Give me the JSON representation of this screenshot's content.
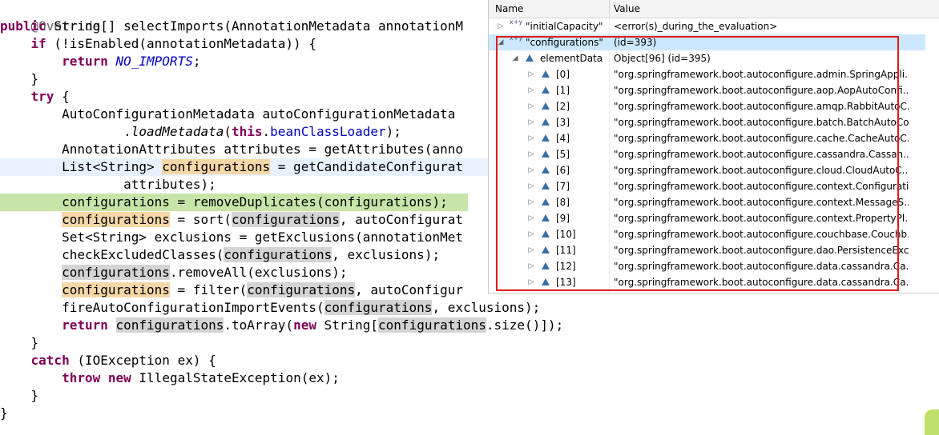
{
  "code": {
    "override": "@Override",
    "l1_public": "public",
    "l1_rest": " String[] selectImports(AnnotationMetadata annotationM",
    "l2_if": "if",
    "l2_rest": " (!isEnabled(annotationMetadata)) {",
    "l3_return": "return",
    "l3_const": "NO_IMPORTS",
    "l3_end": ";",
    "close_brace": "}",
    "l5_try": "try",
    "l5_rest": " {",
    "l6": "AutoConfigurationMetadata autoConfigurationMetadata",
    "l7_dot": ".",
    "l7_method": "loadMetadata",
    "l7_open": "(",
    "l7_this": "this",
    "l7_dot2": ".",
    "l7_field": "beanClassLoader",
    "l7_end": ");",
    "l8": "AnnotationAttributes attributes = getAttributes(anno",
    "l9_a": "List<String> ",
    "l9_var": "configurations",
    "l9_b": " = getCandidateConfigurat",
    "l10": "attributes);",
    "l11": "configurations = removeDuplicates(configurations);",
    "l12_var": "configurations",
    "l12_a": " = sort(",
    "l12_var2": "configurations",
    "l12_b": ", autoConfigurat",
    "l13": "Set<String> exclusions = getExclusions(annotationMet",
    "l14_a": "checkExcludedClasses(",
    "l14_var": "configurations",
    "l14_b": ", exclusions);",
    "l15_var": "configurations",
    "l15_b": ".removeAll(exclusions);",
    "l16_var": "configurations",
    "l16_a": " = filter(",
    "l16_var2": "configurations",
    "l16_b": ", autoConfigur",
    "l17_a": "fireAutoConfigurationImportEvents(",
    "l17_var": "configurations",
    "l17_b": ", exclusions);",
    "l18_return": "return",
    "l18_sp": " ",
    "l18_var": "configurations",
    "l18_a": ".toArray(",
    "l18_new": "new",
    "l18_b": " String[",
    "l18_var2": "configurations",
    "l18_c": ".size()]);",
    "l20_catch": "catch",
    "l20_rest": " (IOException ex) {",
    "l21_throw": "throw",
    "l21_sp": " ",
    "l21_new": "new",
    "l21_rest": " IllegalStateException(ex);"
  },
  "variables": {
    "header_name": "Name",
    "header_value": "Value",
    "initial_capacity": {
      "name": "\"initialCapacity\"",
      "value": "<error(s)_during_the_evaluation>"
    },
    "configurations": {
      "name": "\"configurations\"",
      "value": "(id=393)"
    },
    "element_data": {
      "name": "elementData",
      "value": "Object[96]  (id=395)"
    },
    "elements": [
      {
        "index": "[0]",
        "value": "\"org.springframework.boot.autoconfigure.admin.SpringAppli..."
      },
      {
        "index": "[1]",
        "value": "\"org.springframework.boot.autoconfigure.aop.AopAutoConfi..."
      },
      {
        "index": "[2]",
        "value": "\"org.springframework.boot.autoconfigure.amqp.RabbitAutoC..."
      },
      {
        "index": "[3]",
        "value": "\"org.springframework.boot.autoconfigure.batch.BatchAutoCo..."
      },
      {
        "index": "[4]",
        "value": "\"org.springframework.boot.autoconfigure.cache.CacheAutoC..."
      },
      {
        "index": "[5]",
        "value": "\"org.springframework.boot.autoconfigure.cassandra.Cassan..."
      },
      {
        "index": "[6]",
        "value": "\"org.springframework.boot.autoconfigure.cloud.CloudAutoC..."
      },
      {
        "index": "[7]",
        "value": "\"org.springframework.boot.autoconfigure.context.Configurati..."
      },
      {
        "index": "[8]",
        "value": "\"org.springframework.boot.autoconfigure.context.MessageS..."
      },
      {
        "index": "[9]",
        "value": "\"org.springframework.boot.autoconfigure.context.PropertyPl..."
      },
      {
        "index": "[10]",
        "value": "\"org.springframework.boot.autoconfigure.couchbase.Couchb..."
      },
      {
        "index": "[11]",
        "value": "\"org.springframework.boot.autoconfigure.dao.PersistenceExc..."
      },
      {
        "index": "[12]",
        "value": "\"org.springframework.boot.autoconfigure.data.cassandra.Ca..."
      },
      {
        "index": "[13]",
        "value": "\"org.springframework.boot.autoconfigure.data.cassandra.Ca..."
      }
    ]
  },
  "icons": {
    "expanded": "expanded-triangle-icon",
    "collapsed": "collapsed-triangle-icon",
    "field": "field-icon",
    "local_var": "xy-variable-icon",
    "xy_label": "x+y"
  },
  "colors": {
    "keyword": "#7f0055",
    "constant": "#0000c0",
    "debug_line": "#c7e5a8",
    "current_line": "#e8f2fe",
    "occurrence": "#d4d4d4",
    "write_occurrence": "#f5d7a8",
    "selection": "#cce8ff",
    "red_box": "#e21b1b"
  }
}
